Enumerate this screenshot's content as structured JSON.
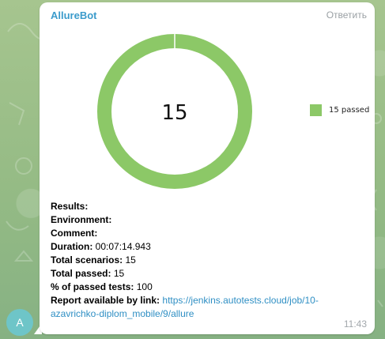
{
  "message": {
    "sender": "AllureBot",
    "reply_label": "Ответить",
    "time": "11:43",
    "avatar_letter": "A"
  },
  "chart_data": {
    "type": "pie",
    "center_label": "15",
    "slices": [
      {
        "label": "passed",
        "value": 15,
        "color": "#8cc867"
      }
    ],
    "legend": [
      {
        "text": "15 passed",
        "color": "#8cc867"
      }
    ],
    "legend_position": "right"
  },
  "report": {
    "results_label": "Results:",
    "environment_label": "Environment:",
    "comment_label": "Comment:",
    "duration_label": "Duration:",
    "duration_value": "00:07:14.943",
    "scenarios_label": "Total scenarios:",
    "scenarios_value": "15",
    "passed_label": "Total passed:",
    "passed_value": "15",
    "percent_label": "% of passed tests:",
    "percent_value": "100",
    "link_label": "Report available by link:",
    "link_url": "https://jenkins.autotests.cloud/job/10-azavrichko-diplom_mobile/9/allure"
  }
}
